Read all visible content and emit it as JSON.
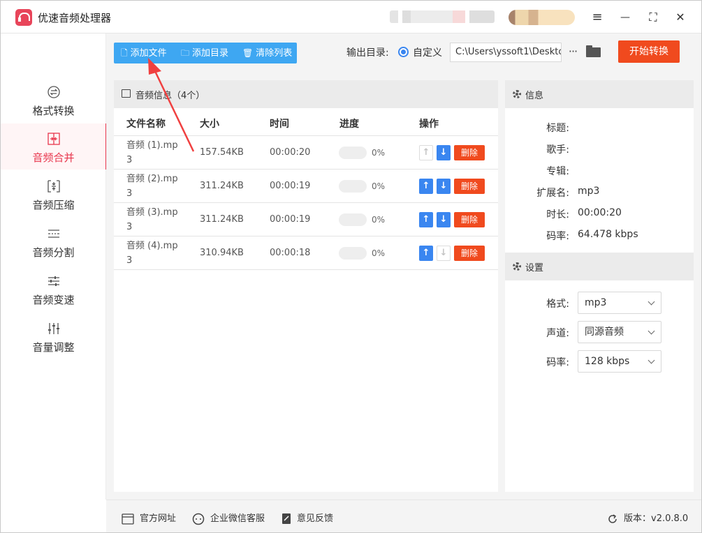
{
  "app": {
    "title": "优速音频处理器"
  },
  "window_controls": {
    "menu": "≡",
    "minimize": "—",
    "maximize": "⛶",
    "close": "✕"
  },
  "sidebar": {
    "items": [
      {
        "label": "格式转换",
        "icon": "format-convert-icon",
        "active": false
      },
      {
        "label": "音频合并",
        "icon": "merge-icon",
        "active": true
      },
      {
        "label": "音频压缩",
        "icon": "compress-icon",
        "active": false
      },
      {
        "label": "音频分割",
        "icon": "split-icon",
        "active": false
      },
      {
        "label": "音频变速",
        "icon": "speed-icon",
        "active": false
      },
      {
        "label": "音量调整",
        "icon": "volume-icon",
        "active": false
      }
    ]
  },
  "toolbar": {
    "add_file": "添加文件",
    "add_dir": "添加目录",
    "clear_list": "清除列表",
    "output_label": "输出目录:",
    "custom_label": "自定义",
    "path_value": "C:\\Users\\yssoft1\\Deskto",
    "more": "···",
    "start": "开始转换"
  },
  "file_panel": {
    "title": "音频信息（4个）",
    "columns": [
      "文件名称",
      "大小",
      "时间",
      "进度",
      "操作"
    ],
    "delete_label": "删除",
    "rows": [
      {
        "name": "音频 (1).mp3",
        "size": "157.54KB",
        "time": "00:00:20",
        "progress": 0,
        "progress_text": "0%",
        "up_enabled": false,
        "down_enabled": true
      },
      {
        "name": "音频 (2).mp3",
        "size": "311.24KB",
        "time": "00:00:19",
        "progress": 0,
        "progress_text": "0%",
        "up_enabled": true,
        "down_enabled": true
      },
      {
        "name": "音频 (3).mp3",
        "size": "311.24KB",
        "time": "00:00:19",
        "progress": 0,
        "progress_text": "0%",
        "up_enabled": true,
        "down_enabled": true
      },
      {
        "name": "音频 (4).mp3",
        "size": "310.94KB",
        "time": "00:00:18",
        "progress": 0,
        "progress_text": "0%",
        "up_enabled": true,
        "down_enabled": false
      }
    ]
  },
  "info": {
    "title": "信息",
    "fields": [
      {
        "key": "标题:",
        "value": ""
      },
      {
        "key": "歌手:",
        "value": ""
      },
      {
        "key": "专辑:",
        "value": ""
      },
      {
        "key": "扩展名:",
        "value": "mp3"
      },
      {
        "key": "时长:",
        "value": "00:00:20"
      },
      {
        "key": "码率:",
        "value": "64.478 kbps"
      }
    ]
  },
  "settings": {
    "title": "设置",
    "fields": [
      {
        "key": "格式:",
        "value": "mp3"
      },
      {
        "key": "声道:",
        "value": "同源音频"
      },
      {
        "key": "码率:",
        "value": "128 kbps"
      }
    ]
  },
  "footer": {
    "website": "官方网址",
    "wechat": "企业微信客服",
    "feedback": "意见反馈",
    "version": "版本：v2.0.8.0"
  },
  "colors": {
    "accent_red": "#e8364d",
    "start_orange": "#f04a1e",
    "toolbar_blue": "#3ea7f2",
    "arrow_blue": "#3a86f0"
  }
}
